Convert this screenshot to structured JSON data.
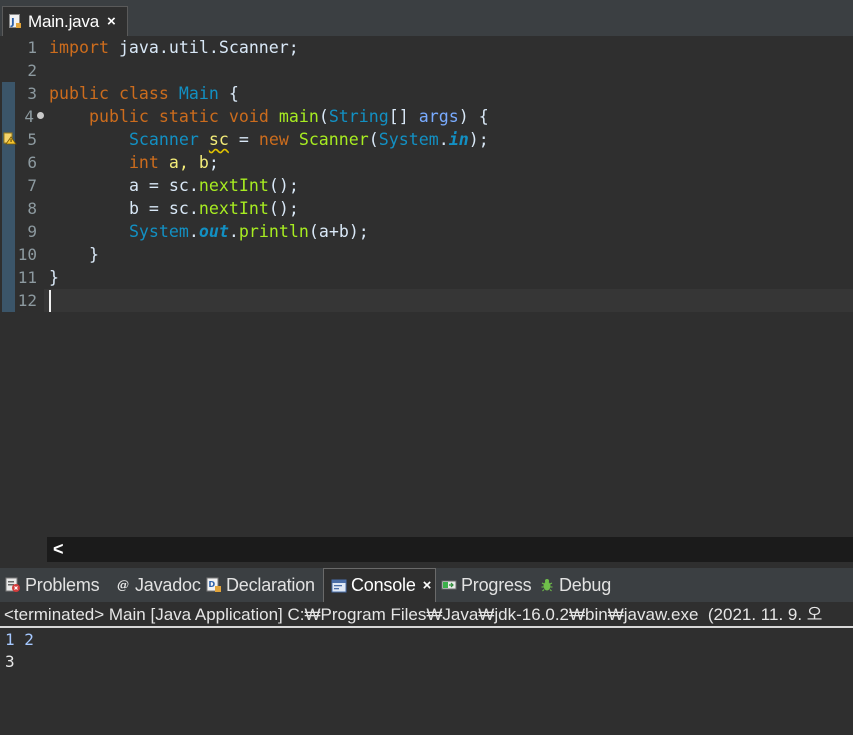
{
  "editor": {
    "tab": {
      "label": "Main.java",
      "close": "×"
    },
    "line_numbers": [
      "1",
      "2",
      "3",
      "4",
      "5",
      "6",
      "7",
      "8",
      "9",
      "10",
      "11",
      "12"
    ],
    "code": {
      "l1": {
        "kw": "import",
        "rest": " java.util.Scanner;"
      },
      "l3": {
        "kw1": "public",
        "kw2": "class",
        "cls": "Main",
        "rest": " {"
      },
      "l4": {
        "kw1": "public",
        "kw2": "static",
        "kw3": "void",
        "meth": "main",
        "p1": "(",
        "cls": "String",
        "p2": "[] ",
        "param": "args",
        "p3": ") {"
      },
      "l5": {
        "cls1": "Scanner",
        "var": "sc",
        "op": " = ",
        "kw": "new",
        "cls2": "Scanner",
        "p1": "(",
        "cls3": "System",
        "dot": ".",
        "field": "in",
        "p2": ");"
      },
      "l6": {
        "kw": "int",
        "vars": "a, b",
        "end": ";"
      },
      "l7": {
        "var1": "a",
        "op": " = ",
        "var2": "sc",
        "dot": ".",
        "meth": "nextInt",
        "end": "();"
      },
      "l8": {
        "var1": "b",
        "op": " = ",
        "var2": "sc",
        "dot": ".",
        "meth": "nextInt",
        "end": "();"
      },
      "l9": {
        "cls": "System",
        "dot1": ".",
        "field": "out",
        "dot2": ".",
        "meth": "println",
        "p1": "(",
        "a": "a",
        "plus": "+",
        "b": "b",
        "p2": ");"
      },
      "l10": {
        "text": "}"
      },
      "l11": {
        "text": "}"
      }
    },
    "hscroll_left": "<"
  },
  "panel": {
    "tabs": [
      {
        "label": "Problems"
      },
      {
        "label": "Javadoc"
      },
      {
        "label": "Declaration"
      },
      {
        "label": "Console",
        "close": "×"
      },
      {
        "label": "Progress"
      },
      {
        "label": "Debug"
      }
    ],
    "console_header": "<terminated> Main [Java Application] C:₩Program Files₩Java₩jdk-16.0.2₩bin₩javaw.exe  (2021. 11. 9. 오",
    "console_lines": [
      {
        "text": "1 2",
        "color": "#a5c8ff"
      },
      {
        "text": "3",
        "color": "#e8e8e8"
      }
    ]
  },
  "colors": {
    "background": "#2f2f2f",
    "keyword": "#cc6c1d",
    "class": "#1290c3",
    "method": "#a7ec21",
    "variable": "#f3ec79",
    "parameter": "#79abff"
  },
  "icons": {
    "editor_tab": "java-file-icon",
    "warning": "warning-icon",
    "problems": "problems-icon",
    "javadoc": "javadoc-icon",
    "declaration": "declaration-icon",
    "console": "console-icon",
    "progress": "progress-icon",
    "debug": "debug-icon"
  }
}
